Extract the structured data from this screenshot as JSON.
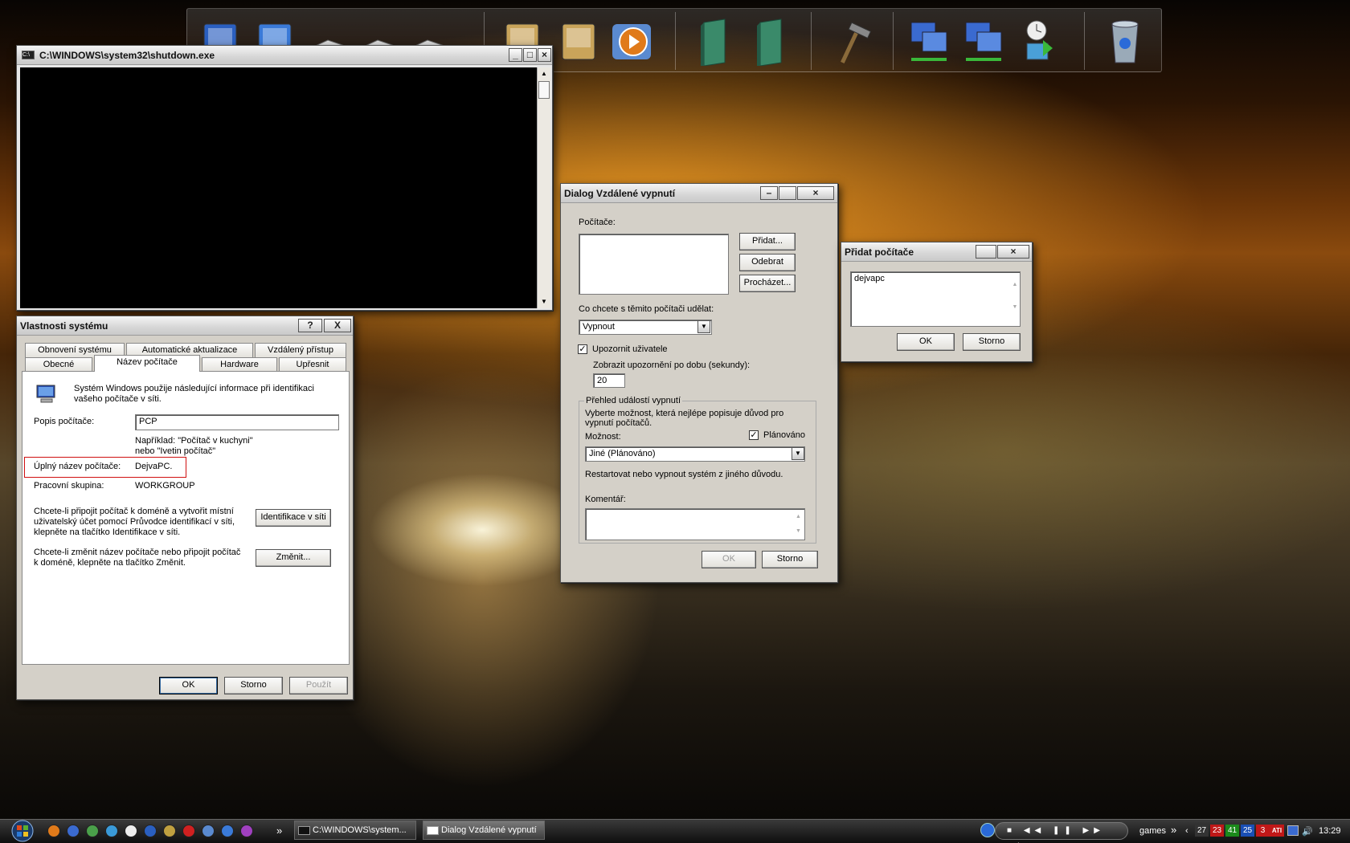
{
  "dock": {
    "icons": [
      "computer-icon",
      "network-places-icon",
      "drive-icon",
      "drive-icon",
      "drive-icon",
      "folder-icon",
      "media-folder-icon",
      "media-player-icon",
      "book-icon",
      "book-icon",
      "hammer-icon",
      "network-icon",
      "network-connections-icon",
      "clock-icon",
      "recycle-bin-icon"
    ]
  },
  "cmd": {
    "title": "C:\\WINDOWS\\system32\\shutdown.exe"
  },
  "sysprops": {
    "title": "Vlastnosti systému",
    "tabs_back": [
      "Obnovení systému",
      "Automatické aktualizace",
      "Vzdálený přístup"
    ],
    "tabs_front": [
      "Obecné",
      "Název počítače",
      "Hardware",
      "Upřesnit"
    ],
    "info": "Systém Windows použije následující informace při identifikaci vašeho počítače v síti.",
    "desc_label": "Popis počítače:",
    "desc_value": "PCP",
    "example1": "Například: \"Počítač v kuchyni\"",
    "example2": "nebo \"Ivetin počítač\"",
    "fullname_label": "Úplný název počítače:",
    "fullname_value": "DejvaPC.",
    "workgroup_label": "Pracovní skupina:",
    "workgroup_value": "WORKGROUP",
    "network_text": "Chcete-li připojit počítač k doméně a vytvořit místní uživatelský účet pomocí Průvodce identifikací v síti, klepněte na tlačítko Identifikace v síti.",
    "network_button": "Identifikace v síti",
    "change_text": "Chcete-li změnit název počítače nebo připojit počítač k doméně, klepněte na tlačítko Změnit.",
    "change_button": "Změnit...",
    "ok": "OK",
    "cancel": "Storno",
    "apply": "Použít",
    "help": "?",
    "close": "X"
  },
  "remote": {
    "title": "Dialog Vzdálené vypnutí",
    "computers_label": "Počítače:",
    "add": "Přidat...",
    "remove": "Odebrat",
    "browse": "Procházet...",
    "action_label": "Co chcete s těmito počítači udělat:",
    "action_value": "Vypnout",
    "warn_label": "Upozornit uživatele",
    "warn_checked": "✓",
    "timeout_label": "Zobrazit upozornění po dobu (sekundy):",
    "timeout_value": "20",
    "group_label": "Přehled událostí vypnutí",
    "group_desc": "Vyberte možnost, která nejlépe popisuje důvod pro vypnutí počítačů.",
    "option_label": "Možnost:",
    "planned_label": "Plánováno",
    "planned_checked": "✓",
    "option_value": "Jiné (Plánováno)",
    "reason_text": "Restartovat nebo vypnout systém z jiného důvodu.",
    "comment_label": "Komentář:",
    "ok": "OK",
    "cancel": "Storno"
  },
  "addpc": {
    "title": "Přidat počítače",
    "text": "dejvapc",
    "ok": "OK",
    "cancel": "Storno"
  },
  "taskbar": {
    "task1": "C:\\WINDOWS\\system...",
    "task2": "Dialog Vzdálené vypnutí",
    "more": "»",
    "folder": "games",
    "tray_nums": [
      "27",
      "23",
      "41",
      "25",
      "3"
    ],
    "tray_nums_colors": [
      "#333333",
      "#c01818",
      "#1b8a1b",
      "#1a4fb5",
      "#c01818"
    ],
    "clock": "13:29"
  }
}
